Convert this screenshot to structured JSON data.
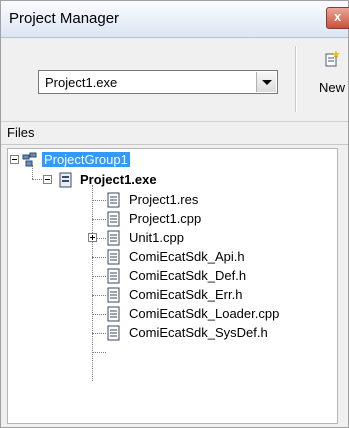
{
  "window": {
    "title": "Project Manager",
    "close_label": "x"
  },
  "toolbar": {
    "project_combo_value": "Project1.exe",
    "new_label": "New"
  },
  "files_header": "Files",
  "tree": {
    "group": "ProjectGroup1",
    "project": "Project1.exe",
    "files": [
      "Project1.res",
      "Project1.cpp",
      "Unit1.cpp",
      "ComiEcatSdk_Api.h",
      "ComiEcatSdk_Def.h",
      "ComiEcatSdk_Err.h",
      "ComiEcatSdk_Loader.cpp",
      "ComiEcatSdk_SysDef.h"
    ]
  },
  "colors": {
    "selection": "#3399ff",
    "titlebar": "#dbe6f3"
  }
}
